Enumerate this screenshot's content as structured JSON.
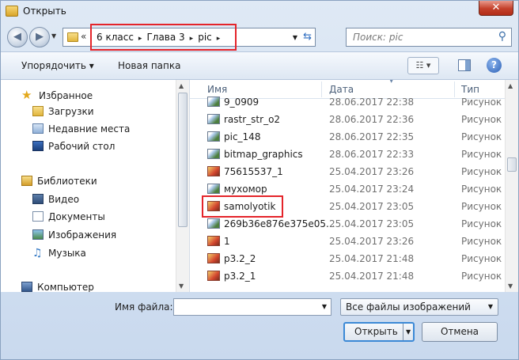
{
  "window": {
    "title": "Открыть",
    "close_label": "✕"
  },
  "address": {
    "overflow": "«",
    "crumbs": [
      "6 класс",
      "Глава 3",
      "pic"
    ],
    "separator": "▸"
  },
  "search": {
    "placeholder": "Поиск: pic"
  },
  "toolbar": {
    "organize_label": "Упорядочить ▾",
    "new_folder_label": "Новая папка",
    "views_label": "☷ ▾",
    "help_label": "?"
  },
  "navpane": {
    "favorites": {
      "label": "Избранное",
      "items": [
        "Загрузки",
        "Недавние места",
        "Рабочий стол"
      ]
    },
    "libraries": {
      "label": "Библиотеки",
      "items": [
        "Видео",
        "Документы",
        "Изображения",
        "Музыка"
      ]
    },
    "computer": {
      "label": "Компьютер"
    }
  },
  "filelist": {
    "columns": {
      "name": "Имя",
      "date": "Дата",
      "type": "Тип"
    },
    "rows": [
      {
        "name": "9_0909",
        "date": "28.06.2017 22:38",
        "type": "Рисунок",
        "icon": "bmp"
      },
      {
        "name": "rastr_str_o2",
        "date": "28.06.2017 22:36",
        "type": "Рисунок",
        "icon": "bmp"
      },
      {
        "name": "pic_148",
        "date": "28.06.2017 22:35",
        "type": "Рисунок",
        "icon": "bmp"
      },
      {
        "name": "bitmap_graphics",
        "date": "28.06.2017 22:33",
        "type": "Рисунок",
        "icon": "bmp"
      },
      {
        "name": "75615537_1",
        "date": "25.04.2017 23:26",
        "type": "Рисунок",
        "icon": "jpg"
      },
      {
        "name": "мухомор",
        "date": "25.04.2017 23:24",
        "type": "Рисунок",
        "icon": "bmp"
      },
      {
        "name": "samolyotik",
        "date": "25.04.2017 23:05",
        "type": "Рисунок",
        "icon": "jpg",
        "highlighted": true
      },
      {
        "name": "269b36e876e375e05...",
        "date": "25.04.2017 23:05",
        "type": "Рисунок",
        "icon": "bmp"
      },
      {
        "name": "1",
        "date": "25.04.2017 23:26",
        "type": "Рисунок",
        "icon": "jpg"
      },
      {
        "name": "p3.2_2",
        "date": "25.04.2017 21:48",
        "type": "Рисунок",
        "icon": "jpg"
      },
      {
        "name": "p3.2_1",
        "date": "25.04.2017 21:48",
        "type": "Рисунок",
        "icon": "jpg"
      }
    ]
  },
  "bottom": {
    "filename_label": "Имя файла:",
    "filename_value": "",
    "filter_value": "Все файлы изображений",
    "open_label": "Открыть",
    "cancel_label": "Отмена"
  },
  "colors": {
    "highlight_box": "#e4242a",
    "window_bg": "#dfe9f5",
    "close_button": "#c4402b"
  }
}
